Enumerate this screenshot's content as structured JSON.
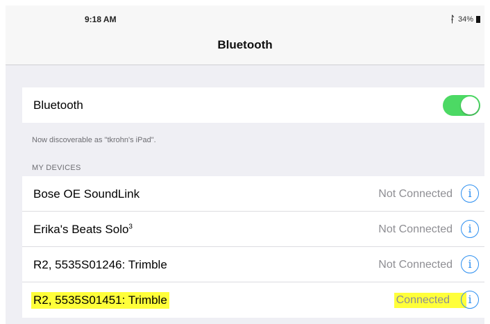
{
  "status_bar": {
    "time": "9:18 AM",
    "bluetooth_icon": "bluetooth-icon",
    "battery": "34%",
    "battery_icon": "battery-icon"
  },
  "nav": {
    "title": "Bluetooth"
  },
  "bluetooth_toggle": {
    "label": "Bluetooth",
    "on": true,
    "accent": "#4cd964"
  },
  "discoverable_note": "Now discoverable as \"tkrohn's iPad\".",
  "my_devices": {
    "header": "MY DEVICES",
    "devices": [
      {
        "name": "Bose OE SoundLink",
        "status": "Not Connected"
      },
      {
        "name": "Erika's Beats Solo",
        "name_suffix": "3",
        "status": "Not Connected"
      },
      {
        "name": "R2, 5535S01246: Trimble",
        "status": "Not Connected"
      },
      {
        "name": "R2, 5535S01451: Trimble",
        "status": "Connected",
        "highlighted": true
      }
    ],
    "info_icon": "info-icon"
  },
  "colors": {
    "link_blue": "#2b8ef0",
    "highlight_yellow": "#ffff3a"
  }
}
